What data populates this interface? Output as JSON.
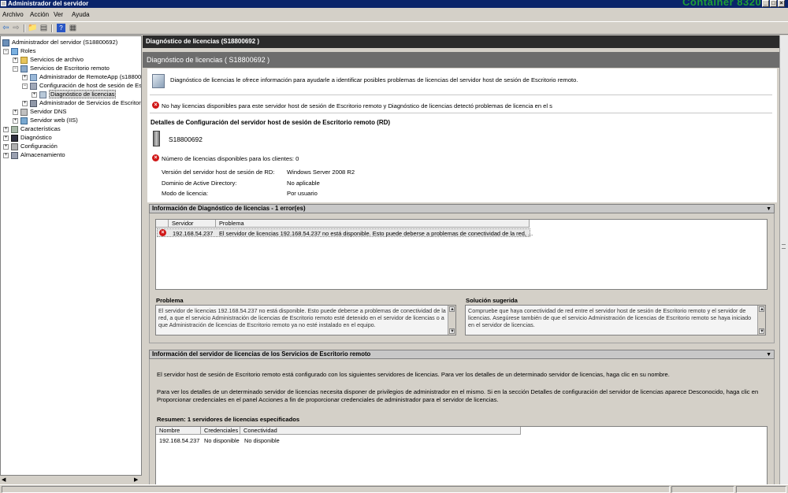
{
  "window": {
    "title": "Administrador del servidor",
    "watermark": "Container 8320"
  },
  "menu": [
    "Archivo",
    "Acción",
    "Ver",
    "Ayuda"
  ],
  "tree": {
    "root": "Administrador del servidor (S18800692)",
    "roles": "Roles",
    "file_services": "Servicios de archivo",
    "rd_services": "Servicios de Escritorio remoto",
    "remoteapp": "Administrador de RemoteApp (s18800692)",
    "rdsh_config": "Configuración de host de sesión de Escritorio remoto",
    "license_diag": "Diagnóstico de licencias",
    "rd_services_manager": "Administrador de Servicios de Escritorio remoto",
    "dns": "Servidor DNS",
    "iis": "Servidor web (IIS)",
    "features": "Características",
    "diagnostics": "Diagnóstico",
    "configuration": "Configuración",
    "storage": "Almacenamiento"
  },
  "content": {
    "header": "Diagnóstico de licencias   (S18800692 )",
    "banner": "Diagnóstico de licencias ( S18800692 )",
    "intro": "Diagnóstico de licencias le ofrece información para ayudarle a identificar posibles problemas de licencias del servidor host de sesión de Escritorio remoto.",
    "warning": "No hay licencias disponibles para este servidor host de sesión de Escritorio remoto y Diagnóstico de licencias detectó problemas de licencia en el s",
    "details_title": "Detalles de Configuración del servidor host de sesión de Escritorio remoto (RD)",
    "server_name": "S18800692",
    "licenses_available": "Número de licencias disponibles para los clientes: 0",
    "props": [
      {
        "label": "Versión del servidor host de sesión de RD:",
        "value": "Windows Server 2008 R2"
      },
      {
        "label": "Dominio de Active Directory:",
        "value": "No aplicable"
      },
      {
        "label": "Modo de licencia:",
        "value": "Por usuario"
      }
    ]
  },
  "diag_section": {
    "title": "Información de Diagnóstico de licencias - 1 error(es)",
    "columns": [
      "Servidor",
      "Problema"
    ],
    "rows": [
      {
        "server": "192.168.54.237",
        "problem": "El servidor de licencias 192.168.54.237 no está disponible. Esto puede deberse a problemas de conectividad de la red, ..."
      }
    ],
    "problem_label": "Problema",
    "problem_text": "El servidor de licencias 192.168.54.237 no está disponible. Esto puede deberse a problemas de conectividad de la red, a que el servicio Administración de licencias de Escritorio remoto esté detenido en el servidor de licencias o a que Administración de licencias de Escritorio remoto ya no esté instalado en el equipo.",
    "solution_label": "Solución sugerida",
    "solution_text": "Compruebe que haya conectividad de red entre el servidor host de sesión de Escritorio remoto y el servidor de licencias. Asegúrese también de que el servicio Administración de licencias de Escritorio remoto se haya iniciado en el servidor de licencias."
  },
  "ls_section": {
    "title": "Información del servidor de licencias de los Servicios de Escritorio remoto",
    "p1": "El servidor host de sesión de Escritorio remoto está configurado con los siguientes servidores de licencias. Para ver los detalles de un determinado servidor de licencias, haga clic en su nombre.",
    "p2": "Para ver los detalles de un determinado servidor de licencias necesita disponer de privilegios de administrador en el mismo. Si en la sección Detalles de configuración del servidor de licencias aparece Desconocido, haga clic en Proporcionar credenciales en el panel Acciones a fin de proporcionar credenciales de administrador para el servidor de licencias.",
    "summary": "Resumen: 1 servidores de licencias especificados",
    "columns": [
      "Nombre",
      "Credenciales",
      "Conectividad"
    ],
    "rows": [
      {
        "name": "192.168.54.237",
        "credentials": "No disponible",
        "connectivity": "No disponible"
      }
    ]
  }
}
